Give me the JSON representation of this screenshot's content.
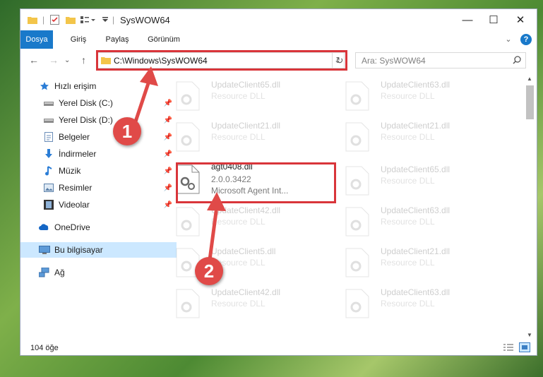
{
  "window": {
    "title": "SysWOW64",
    "controls": {
      "minimize": "—",
      "maximize": "☐",
      "close": "✕"
    }
  },
  "ribbon": {
    "tabs": [
      "Dosya",
      "Giriş",
      "Paylaş",
      "Görünüm"
    ],
    "help": "?",
    "expand": "⌄"
  },
  "nav": {
    "back": "←",
    "forward": "→",
    "up": "↑",
    "address": "C:\\Windows\\SysWOW64",
    "refresh": "↻",
    "search_placeholder": "Ara: SysWOW64"
  },
  "sidebar": {
    "items": [
      {
        "label": "Hızlı erişim",
        "icon": "star-icon",
        "pinned": false
      },
      {
        "label": "Yerel Disk (C:)",
        "icon": "drive-icon",
        "pinned": true
      },
      {
        "label": "Yerel Disk (D:)",
        "icon": "drive-icon",
        "pinned": true
      },
      {
        "label": "Belgeler",
        "icon": "document-icon",
        "pinned": true
      },
      {
        "label": "İndirmeler",
        "icon": "download-icon",
        "pinned": true
      },
      {
        "label": "Müzik",
        "icon": "music-icon",
        "pinned": true
      },
      {
        "label": "Resimler",
        "icon": "picture-icon",
        "pinned": true
      },
      {
        "label": "Videolar",
        "icon": "video-icon",
        "pinned": true
      },
      {
        "label": "OneDrive",
        "icon": "cloud-icon",
        "pinned": false
      },
      {
        "label": "Bu bilgisayar",
        "icon": "computer-icon",
        "pinned": false,
        "selected": true
      },
      {
        "label": "Ağ",
        "icon": "network-icon",
        "pinned": false
      }
    ],
    "pin_glyph": "📌"
  },
  "files": [
    {
      "name": "UpdateClient65.dll",
      "sub1": "Resource DLL",
      "faded": true
    },
    {
      "name": "UpdateClient63.dll",
      "sub1": "Resource DLL",
      "faded": true
    },
    {
      "name": "UpdateClient21.dll",
      "sub1": "Resource DLL",
      "faded": true
    },
    {
      "name": "UpdateClient21.dll",
      "sub1": "Resource DLL",
      "faded": true
    },
    {
      "name": "agt0408.dll",
      "sub1": "2.0.0.3422",
      "sub2": "Microsoft Agent Int...",
      "faded": false,
      "highlighted": true
    },
    {
      "name": "UpdateClient65.dll",
      "sub1": "Resource DLL",
      "faded": true
    },
    {
      "name": "UpdateClient42.dll",
      "sub1": "Resource DLL",
      "faded": true
    },
    {
      "name": "UpdateClient63.dll",
      "sub1": "Resource DLL",
      "faded": true
    },
    {
      "name": "UpdateClient5.dll",
      "sub1": "Resource DLL",
      "faded": true
    },
    {
      "name": "UpdateClient21.dll",
      "sub1": "Resource DLL",
      "faded": true
    },
    {
      "name": "UpdateClient42.dll",
      "sub1": "Resource DLL",
      "faded": true
    },
    {
      "name": "UpdateClient63.dll",
      "sub1": "Resource DLL",
      "faded": true
    }
  ],
  "status": {
    "count": "104 öğe"
  },
  "annotations": {
    "marker1": "1",
    "marker2": "2"
  },
  "colors": {
    "accent": "#1979ca",
    "highlight": "#d9353a",
    "marker": "#e04a48",
    "selected": "#cce8ff"
  }
}
